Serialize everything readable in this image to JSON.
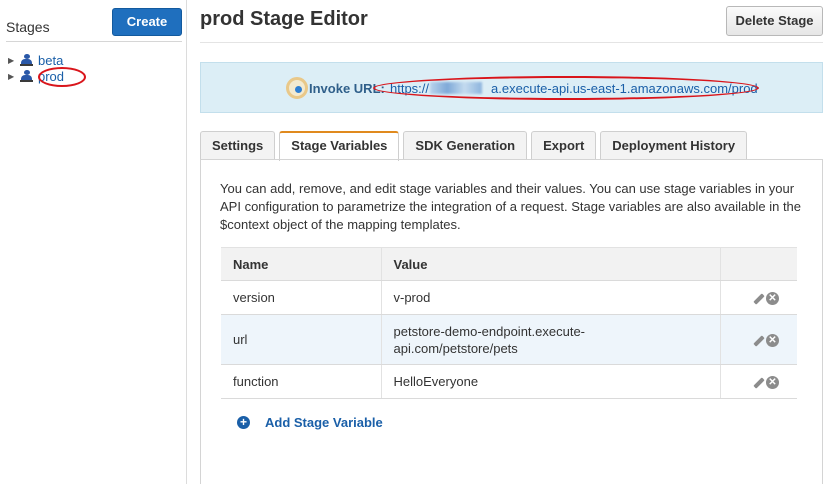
{
  "sidebar": {
    "title": "Stages",
    "create_label": "Create",
    "stages": [
      {
        "label": "beta",
        "active": false
      },
      {
        "label": "prod",
        "active": true
      }
    ]
  },
  "header": {
    "title": "prod Stage Editor",
    "delete_label": "Delete Stage"
  },
  "invoke": {
    "label": "Invoke URL:",
    "url_prefix": "https://",
    "url_suffix": "a.execute-api.us-east-1.amazonaws.com/prod"
  },
  "tabs": [
    {
      "label": "Settings",
      "active": false
    },
    {
      "label": "Stage Variables",
      "active": true
    },
    {
      "label": "SDK Generation",
      "active": false
    },
    {
      "label": "Export",
      "active": false
    },
    {
      "label": "Deployment History",
      "active": false
    }
  ],
  "panel": {
    "description": "You can add, remove, and edit stage variables and their values. You can use stage variables in your API configuration to parametrize the integration of a request. Stage variables are also available in the $context object of the mapping templates.",
    "columns": {
      "name": "Name",
      "value": "Value"
    },
    "rows": [
      {
        "name": "version",
        "value": "v-prod"
      },
      {
        "name": "url",
        "value": "petstore-demo-endpoint.execute-api.com/petstore/pets"
      },
      {
        "name": "function",
        "value": "HelloEveryone"
      }
    ],
    "add_label": "Add Stage Variable"
  },
  "colors": {
    "accent": "#1f6fbe",
    "active_tab": "#e08a1e",
    "invoke_bg": "#dceef6",
    "highlight": "#d9151b"
  }
}
